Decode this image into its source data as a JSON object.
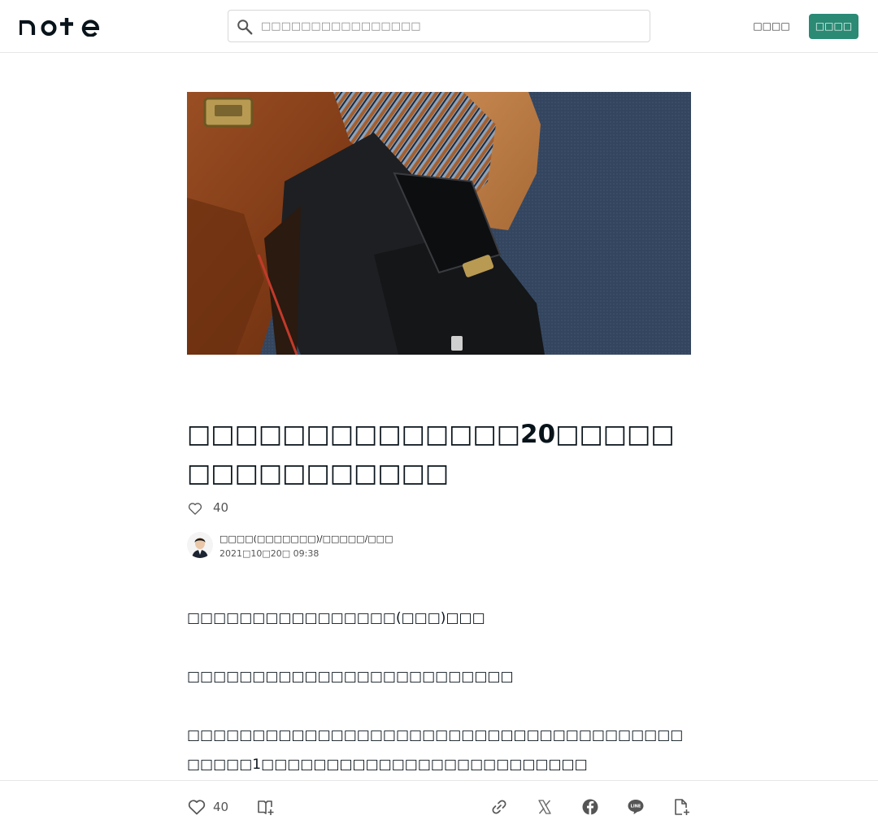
{
  "header": {
    "logo_text": "note",
    "search_placeholder": "□□□□□□□□□□□□□□□□",
    "login_label": "□□□□",
    "signup_label": "□□□□"
  },
  "article": {
    "hero_alt": "",
    "title": "□□□□□□□□□□□□□□20□□□□□□□□□□□□□□□□",
    "like_count": "40",
    "author_name": "□□□□(□□□□□□□)/□□□□□/□□□",
    "date": "2021□10□20□ 09:38",
    "paragraphs": [
      "□□□□□□□□□□□□□□□□(□□□)□□□",
      "□□□□□□□□□□□□□□□□□□□□□□□□□",
      "□□□□□□□□□□□□□□□□□□□□□□□□□□□□□□□□□□□□□□□□□□□1□□□□□□□□□□□□□□□□□□□□□□□□□"
    ]
  },
  "footer": {
    "like_count": "40"
  },
  "colors": {
    "accent": "#2a8a74",
    "text": "#08131a",
    "muted": "#555555"
  },
  "icons": [
    "search-icon",
    "heart-icon",
    "magazine-add-icon",
    "link-icon",
    "x-icon",
    "facebook-icon",
    "line-icon",
    "embed-add-icon"
  ]
}
